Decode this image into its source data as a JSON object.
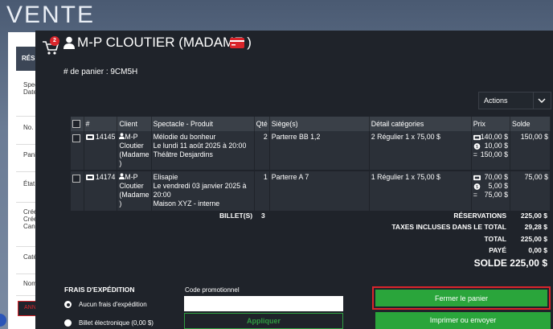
{
  "background": {
    "title": "VENTE",
    "panel_header": "RÉSU",
    "side_labels": [
      "Spectacle",
      "Date",
      "No. de réserva",
      "Panier(s) d'ach",
      "État",
      "Créée le",
      "Créée par",
      "Canal",
      "Catégories",
      "Nombre de bil"
    ],
    "cancel_label": "ANNULER LA R"
  },
  "header": {
    "cart_count": "2",
    "customer_name": "M-P CLOUTIER (MADAME )",
    "panier_label": "# de panier : 9CM5H"
  },
  "actions": {
    "label": "Actions"
  },
  "table": {
    "columns": [
      "",
      "#",
      "Client",
      "Spectacle - Produit",
      "Qté",
      "Siège(s)",
      "Détail catégories",
      "Prix",
      "Solde"
    ],
    "rows": [
      {
        "id": "14145",
        "client_lines": [
          "M-P",
          "Cloutier",
          "(Madame",
          ")"
        ],
        "show_lines": [
          "Mélodie du bonheur",
          "Le lundi 11 août 2025 à 20:00",
          "Théâtre Desjardins"
        ],
        "qty": "2",
        "seats": "Parterre BB 1,2",
        "detail": "2 Régulier 1 x 75,00 $",
        "price_ticket": "140,00 $",
        "price_fee": "10,00 $",
        "price_total_prefix": "=",
        "price_total": "150,00 $",
        "solde": "150,00 $"
      },
      {
        "id": "14174",
        "client_lines": [
          "M-P",
          "Cloutier",
          "(Madame",
          ")"
        ],
        "show_lines": [
          "Elisapie",
          "Le vendredi 03 janvier 2025 à",
          "20:00",
          "Maison XYZ - interne"
        ],
        "qty": "1",
        "seats": "Parterre A 7",
        "detail": "1 Régulier 1 x 75,00 $",
        "price_ticket": "70,00 $",
        "price_fee": "5,00 $",
        "price_total_prefix": "=",
        "price_total": "75,00 $",
        "solde": "75,00 $"
      }
    ]
  },
  "summary": {
    "billets_label": "BILLET(S)",
    "billets_count": "3",
    "reservations_label": "RÉSERVATIONS",
    "reservations_value": "225,00 $",
    "taxes_label": "TAXES INCLUSES DANS LE TOTAL",
    "taxes_value": "29,28 $",
    "total_label": "TOTAL",
    "total_value": "225,00 $",
    "paye_label": "PAYÉ",
    "paye_value": "0,00 $",
    "solde_label": "SOLDE",
    "solde_value": "225,00 $"
  },
  "shipping": {
    "title": "FRAIS D'EXPÉDITION",
    "option1": "Aucun frais d'expédition",
    "option2": "Billet électronique (0,00 $)"
  },
  "promo": {
    "label": "Code promotionnel",
    "value": "",
    "apply_label": "Appliquer"
  },
  "buttons": {
    "close_label": "Fermer le panier",
    "print_label": "Imprimer ou envoyer"
  },
  "colors": {
    "accent_green": "#2aa53b",
    "accent_red": "#d9252b",
    "modal_bg": "#1f232a"
  }
}
